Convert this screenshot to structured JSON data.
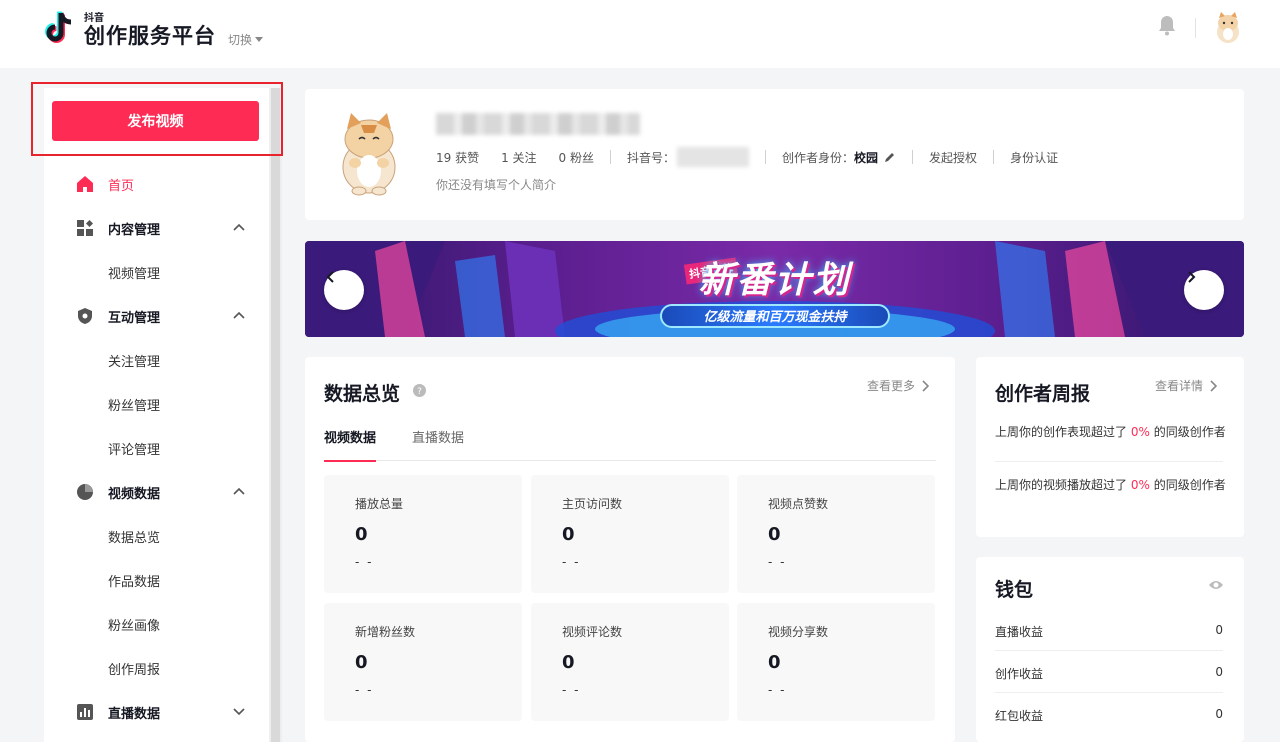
{
  "header": {
    "brand_sub": "抖音",
    "brand_title": "创作服务平台",
    "switch_label": "切换",
    "bell_icon": "bell-icon",
    "avatar_icon": "cat-avatar"
  },
  "sidebar": {
    "publish_label": "发布视频",
    "items": [
      {
        "label": "首页",
        "icon": "home-icon",
        "type": "active"
      },
      {
        "label": "内容管理",
        "icon": "grid-icon",
        "type": "group",
        "chevron": "up"
      },
      {
        "label": "视频管理",
        "type": "sub"
      },
      {
        "label": "互动管理",
        "icon": "shield-icon",
        "type": "group",
        "chevron": "up"
      },
      {
        "label": "关注管理",
        "type": "sub"
      },
      {
        "label": "粉丝管理",
        "type": "sub"
      },
      {
        "label": "评论管理",
        "type": "sub"
      },
      {
        "label": "视频数据",
        "icon": "pie-icon",
        "type": "group",
        "chevron": "up"
      },
      {
        "label": "数据总览",
        "type": "sub"
      },
      {
        "label": "作品数据",
        "type": "sub"
      },
      {
        "label": "粉丝画像",
        "type": "sub"
      },
      {
        "label": "创作周报",
        "type": "sub"
      },
      {
        "label": "直播数据",
        "icon": "bar-chart-icon",
        "type": "group",
        "chevron": "down"
      }
    ]
  },
  "profile": {
    "likes": "19 获赞",
    "following": "1 关注",
    "fans": "0 粉丝",
    "douyin_id_label": "抖音号：",
    "identity_label": "创作者身份：",
    "identity_value": "校园",
    "authorize": "发起授权",
    "verify": "身份认证",
    "bio": "你还没有填写个人简介"
  },
  "banner": {
    "tag": "抖音招募",
    "title": "新番计划",
    "subtitle": "亿级流量和百万现金扶持",
    "colors": {
      "primary": "#5a1e8e",
      "accent": "#fe2c55"
    }
  },
  "overview": {
    "title": "数据总览",
    "more": "查看更多",
    "tabs": [
      "视频数据",
      "直播数据"
    ],
    "metrics": [
      {
        "label": "播放总量",
        "value": "0",
        "delta": "- -"
      },
      {
        "label": "主页访问数",
        "value": "0",
        "delta": "- -"
      },
      {
        "label": "视频点赞数",
        "value": "0",
        "delta": "- -"
      },
      {
        "label": "新增粉丝数",
        "value": "0",
        "delta": "- -"
      },
      {
        "label": "视频评论数",
        "value": "0",
        "delta": "- -"
      },
      {
        "label": "视频分享数",
        "value": "0",
        "delta": "- -"
      }
    ]
  },
  "weekly": {
    "title": "创作者周报",
    "more": "查看详情",
    "line1_pre": "上周你的创作表现超过了",
    "line1_pct": "0%",
    "line1_post": "的同级创作者",
    "line2_pre": "上周你的视频播放超过了",
    "line2_pct": "0%",
    "line2_post": "的同级创作者"
  },
  "wallet": {
    "title": "钱包",
    "rows": [
      {
        "label": "直播收益",
        "value": "0"
      },
      {
        "label": "创作收益",
        "value": "0"
      },
      {
        "label": "红包收益",
        "value": "0"
      }
    ]
  },
  "colors": {
    "brand": "#fe2c55",
    "text": "#161823",
    "bg": "#f4f5f7"
  }
}
